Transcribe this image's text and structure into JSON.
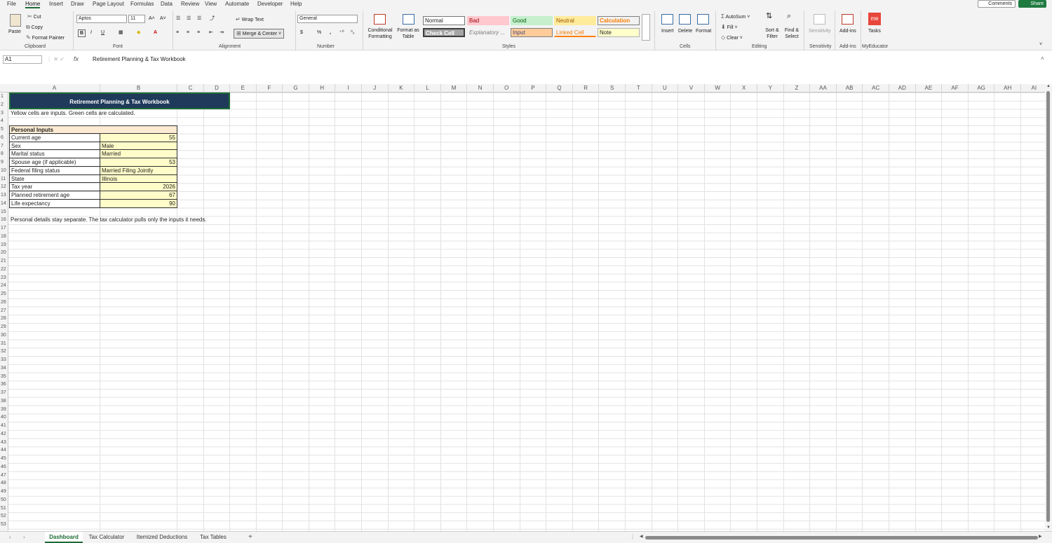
{
  "menu": {
    "file": "File",
    "home": "Home",
    "insert": "Insert",
    "draw": "Draw",
    "page_layout": "Page Layout",
    "formulas": "Formulas",
    "data": "Data",
    "review": "Review",
    "view": "View",
    "automate": "Automate",
    "developer": "Developer",
    "help": "Help",
    "comments": "Comments",
    "share": "Share"
  },
  "ribbon": {
    "clipboard": {
      "paste": "Paste",
      "cut": "Cut",
      "copy": "Copy",
      "format_painter": "Format Painter",
      "label": "Clipboard"
    },
    "font": {
      "name": "Aptos",
      "size": "11",
      "label": "Font",
      "bold": "B",
      "italic": "I",
      "underline": "U"
    },
    "alignment": {
      "wrap": "Wrap Text",
      "merge": "Merge & Center",
      "label": "Alignment"
    },
    "number": {
      "format": "General",
      "currency": "$",
      "percent": "%",
      "comma": ",",
      "label": "Number"
    },
    "styles": {
      "conditional": "Conditional Formatting",
      "format_table": "Format as Table",
      "normal": "Normal",
      "bad": "Bad",
      "good": "Good",
      "neutral": "Neutral",
      "calculation": "Calculation",
      "check_cell": "Check Cell",
      "explanatory": "Explanatory ...",
      "input": "Input",
      "linked_cell": "Linked Cell",
      "note": "Note",
      "label": "Styles"
    },
    "cells": {
      "insert": "Insert",
      "delete": "Delete",
      "format": "Format",
      "label": "Cells"
    },
    "editing": {
      "autosum": "AutoSum",
      "fill": "Fill",
      "clear": "Clear",
      "sort": "Sort & Filter",
      "find": "Find & Select",
      "label": "Editing"
    },
    "sensitivity": {
      "button": "Sensitivity",
      "label": "Sensitivity"
    },
    "addins": {
      "button": "Add-ins",
      "label": "Add-ins"
    },
    "myeducator": {
      "button": "Tasks",
      "icon": "me",
      "label": "MyEducator"
    }
  },
  "formula_bar": {
    "name_box": "A1",
    "fx": "fx",
    "content": "Retirement Planning & Tax Workbook"
  },
  "columns": [
    "A",
    "B",
    "C",
    "D",
    "E",
    "F",
    "G",
    "H",
    "I",
    "J",
    "K",
    "L",
    "M",
    "N",
    "O",
    "P",
    "Q",
    "R",
    "S",
    "T",
    "U",
    "V",
    "W",
    "X",
    "Y",
    "Z",
    "AA",
    "AB",
    "AC",
    "AD",
    "AE",
    "AF",
    "AG",
    "AH",
    "AI"
  ],
  "rows": [
    "1",
    "2",
    "3",
    "4",
    "5",
    "6",
    "7",
    "8",
    "9",
    "10",
    "11",
    "12",
    "13",
    "14",
    "15",
    "16",
    "17",
    "18",
    "19",
    "20",
    "21",
    "22",
    "23",
    "24",
    "25",
    "26",
    "27",
    "28",
    "29",
    "30",
    "31",
    "32",
    "33",
    "34",
    "35",
    "36",
    "37",
    "38",
    "39",
    "40",
    "41",
    "42",
    "43",
    "44",
    "45",
    "46",
    "47",
    "48",
    "49",
    "50",
    "51",
    "52",
    "53"
  ],
  "sheet": {
    "title": "Retirement Planning & Tax Workbook",
    "note": "Yellow cells are inputs. Green cells are calculated.",
    "section_header": "Personal Inputs",
    "inputs": [
      {
        "label": "Current age",
        "value": "55",
        "align": "right"
      },
      {
        "label": "Sex",
        "value": "Male",
        "align": "left"
      },
      {
        "label": "Marital status",
        "value": "Married",
        "align": "left"
      },
      {
        "label": "Spouse age (if applicable)",
        "value": "53",
        "align": "right"
      },
      {
        "label": "Federal filing status",
        "value": "Married Filing Jointly",
        "align": "left"
      },
      {
        "label": "State",
        "value": "Illinois",
        "align": "left"
      },
      {
        "label": "Tax year",
        "value": "2026",
        "align": "right"
      },
      {
        "label": "Planned retirement age",
        "value": "67",
        "align": "right"
      },
      {
        "label": "Life expectancy",
        "value": "90",
        "align": "right"
      }
    ],
    "footer_note": "Personal details stay separate. The tax calculator pulls only the inputs it needs."
  },
  "tabs": [
    "Dashboard",
    "Tax Calculator",
    "Itemized Deductions",
    "Tax Tables"
  ],
  "colors": {
    "title_bg": "#1f3a5a",
    "input_bg": "#fefcc8",
    "header_bg": "#fcebd2",
    "accent": "#1e6b36"
  }
}
